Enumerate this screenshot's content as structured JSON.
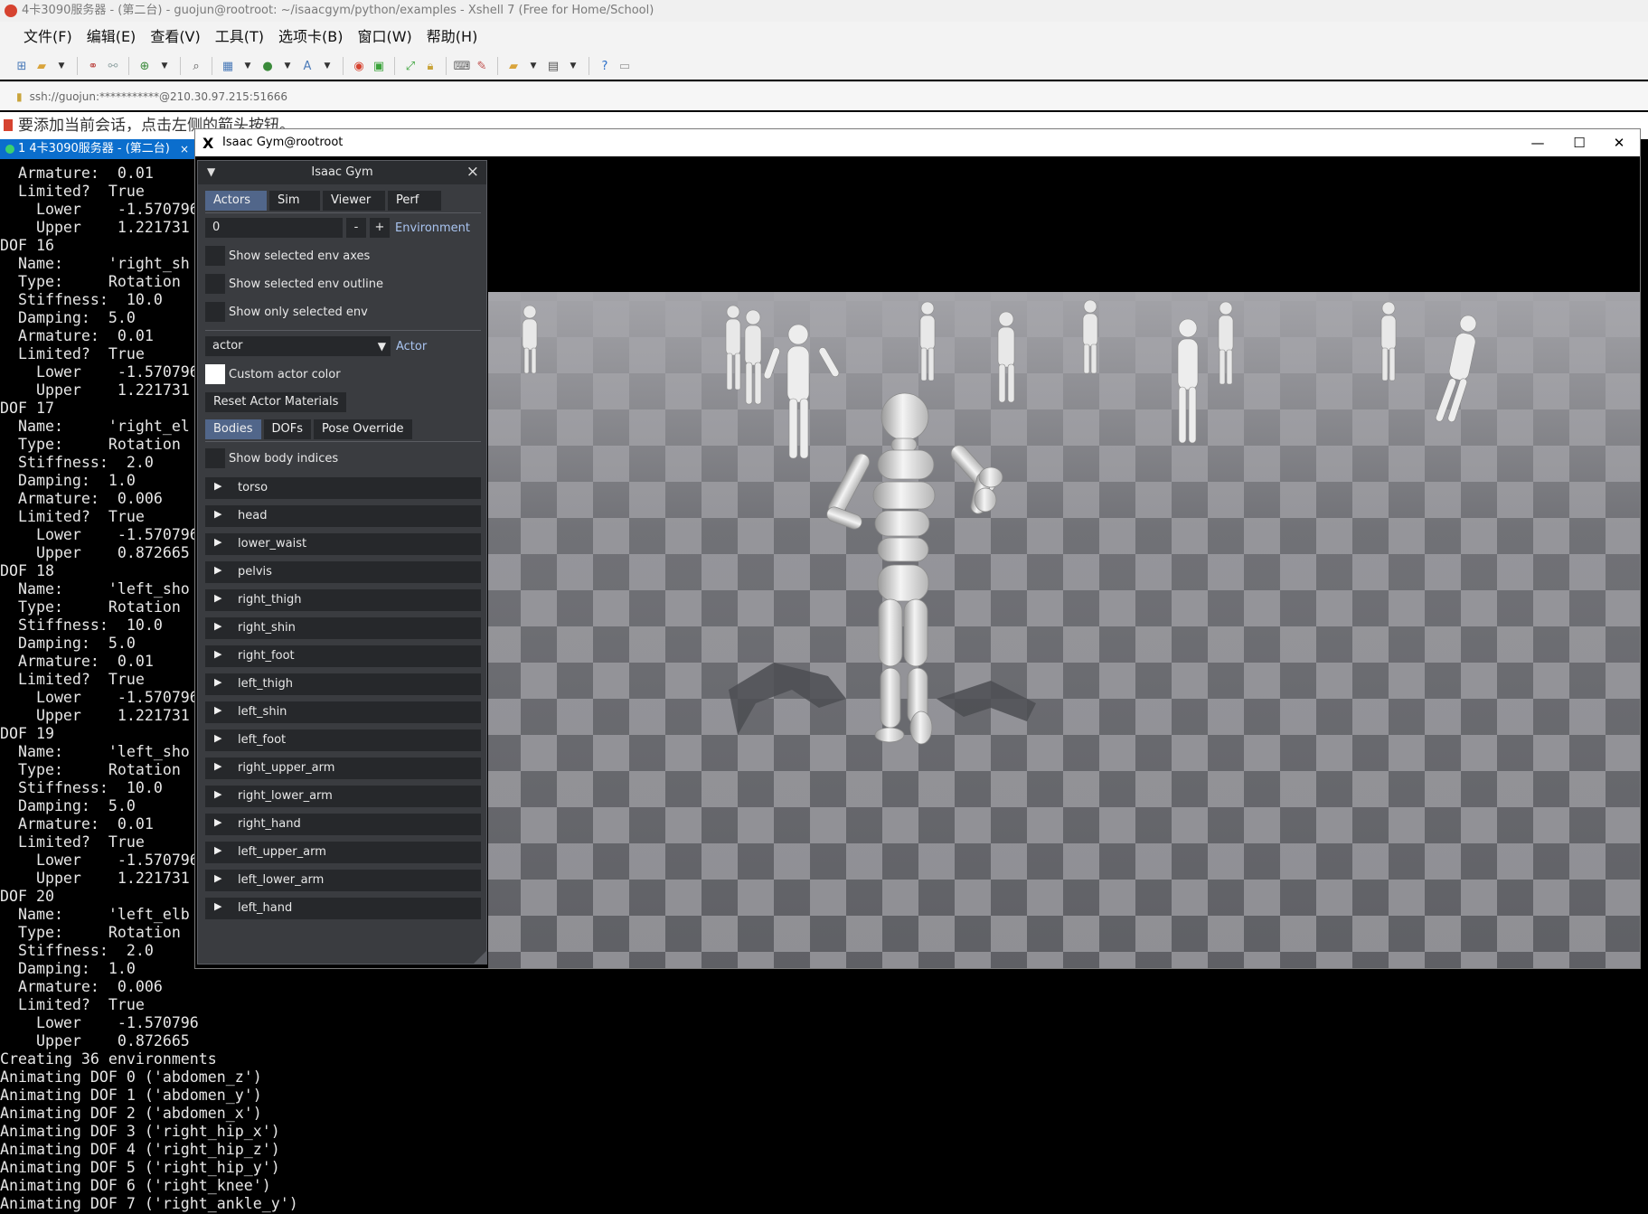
{
  "xshell": {
    "title": "4卡3090服务器 - (第二台) - guojun@rootroot: ~/isaacgym/python/examples - Xshell 7 (Free for Home/School)",
    "menu": [
      "文件(F)",
      "编辑(E)",
      "查看(V)",
      "工具(T)",
      "选项卡(B)",
      "窗口(W)",
      "帮助(H)"
    ],
    "address": "ssh://guojun:***********@210.30.97.215:51666",
    "notice": "要添加当前会话，点击左侧的箭头按钮。",
    "tab_label": "1 4卡3090服务器 - (第二台)"
  },
  "terminal": {
    "lines": [
      "  Armature:  0.01",
      "  Limited?  True",
      "    Lower    -1.570796",
      "    Upper    1.221731",
      "DOF 16",
      "  Name:     'right_sh",
      "  Type:     Rotation",
      "  Stiffness:  10.0",
      "  Damping:  5.0",
      "  Armature:  0.01",
      "  Limited?  True",
      "    Lower    -1.570796",
      "    Upper    1.221731",
      "DOF 17",
      "  Name:     'right_el",
      "  Type:     Rotation",
      "  Stiffness:  2.0",
      "  Damping:  1.0",
      "  Armature:  0.006",
      "  Limited?  True",
      "    Lower    -1.570796",
      "    Upper    0.872665",
      "DOF 18",
      "  Name:     'left_sho",
      "  Type:     Rotation",
      "  Stiffness:  10.0",
      "  Damping:  5.0",
      "  Armature:  0.01",
      "  Limited?  True",
      "    Lower    -1.570796",
      "    Upper    1.221731",
      "DOF 19",
      "  Name:     'left_sho",
      "  Type:     Rotation",
      "  Stiffness:  10.0",
      "  Damping:  5.0",
      "  Armature:  0.01",
      "  Limited?  True",
      "    Lower    -1.570796",
      "    Upper    1.221731",
      "DOF 20",
      "  Name:     'left_elb",
      "  Type:     Rotation",
      "  Stiffness:  2.0",
      "  Damping:  1.0",
      "  Armature:  0.006",
      "  Limited?  True",
      "    Lower    -1.570796",
      "    Upper    0.872665"
    ],
    "log": [
      "Creating 36 environments",
      "Animating DOF 0 ('abdomen_z')",
      "Animating DOF 1 ('abdomen_y')",
      "Animating DOF 2 ('abdomen_x')",
      "Animating DOF 3 ('right_hip_x')",
      "Animating DOF 4 ('right_hip_z')",
      "Animating DOF 5 ('right_hip_y')",
      "Animating DOF 6 ('right_knee')",
      "Animating DOF 7 ('right_ankle_y')"
    ]
  },
  "gym": {
    "window_title": "Isaac Gym@rootroot",
    "window_controls": {
      "minimize": "—",
      "maximize": "☐",
      "close": "✕"
    },
    "panel": {
      "title": "Isaac Gym",
      "tabs": [
        "Actors",
        "Sim",
        "Viewer",
        "Perf"
      ],
      "active_tab": "Actors",
      "env_value": "0",
      "env_minus": "-",
      "env_plus": "+",
      "env_label": "Environment",
      "checkboxes": [
        "Show selected env axes",
        "Show selected env outline",
        "Show only selected env"
      ],
      "actor_select": "actor",
      "actor_label": "Actor",
      "custom_color_label": "Custom actor color",
      "reset_button": "Reset Actor Materials",
      "subtabs": [
        "Bodies",
        "DOFs",
        "Pose Override"
      ],
      "active_subtab": "Bodies",
      "show_indices_label": "Show body indices",
      "bodies": [
        "torso",
        "head",
        "lower_waist",
        "pelvis",
        "right_thigh",
        "right_shin",
        "right_foot",
        "left_thigh",
        "left_shin",
        "left_foot",
        "right_upper_arm",
        "right_lower_arm",
        "right_hand",
        "left_upper_arm",
        "left_lower_arm",
        "left_hand"
      ]
    }
  }
}
